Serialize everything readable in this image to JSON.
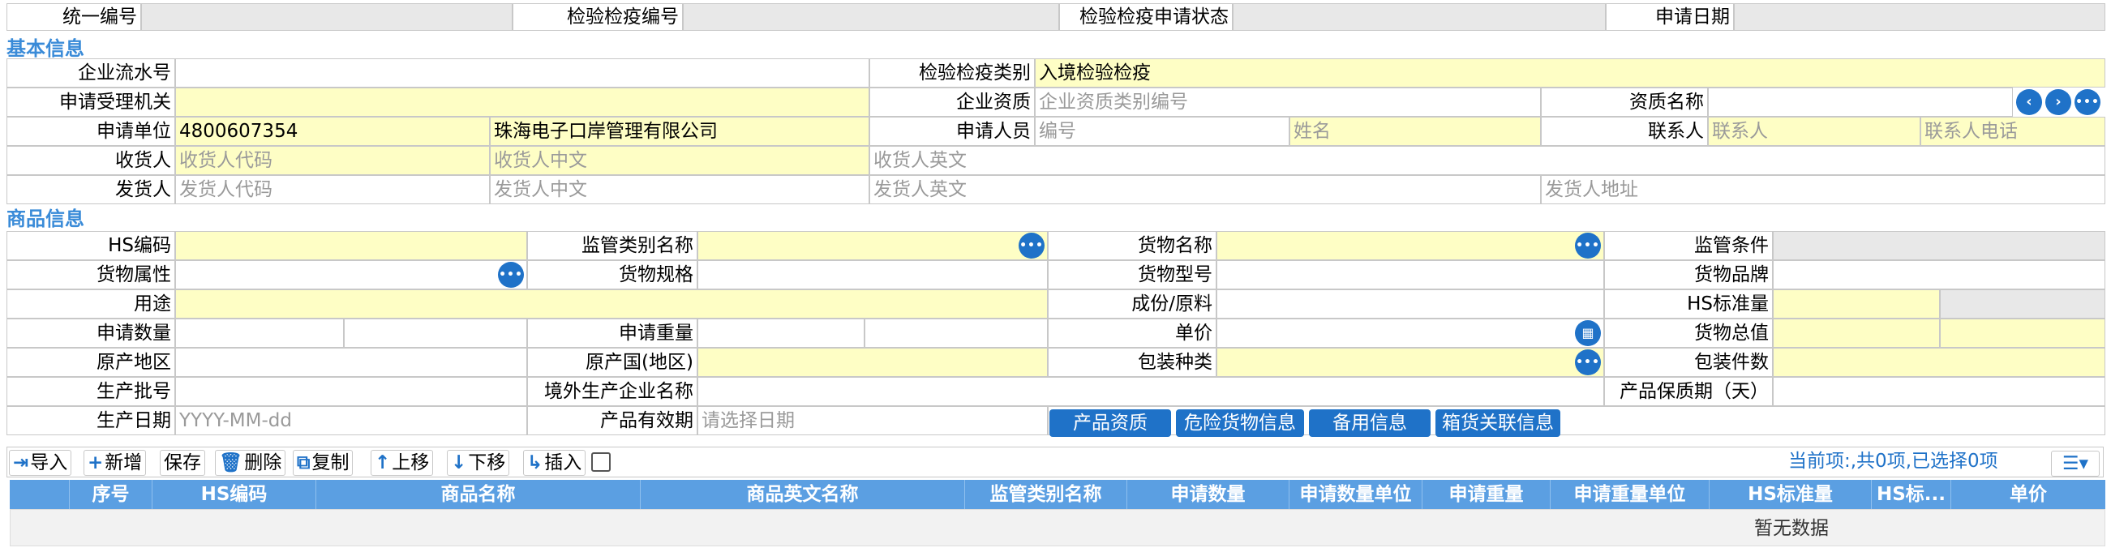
{
  "top": {
    "unified_no_label": "统一编号",
    "inspection_no_label": "检验检疫编号",
    "apply_status_label": "检验检疫申请状态",
    "apply_date_label": "申请日期"
  },
  "basic": {
    "section_title": "基本信息",
    "ent_serial_label": "企业流水号",
    "insp_category_label": "检验检疫类别",
    "insp_category_value": "入境检验检疫",
    "accept_org_label": "申请受理机关",
    "ent_qual_label": "企业资质",
    "ent_qual_placeholder": "企业资质类别编号",
    "qual_name_label": "资质名称",
    "applicant_label": "申请单位",
    "applicant_code": "4800607354",
    "applicant_name": "珠海电子口岸管理有限公司",
    "apply_person_label": "申请人员",
    "apply_person_no_ph": "编号",
    "apply_person_name_ph": "姓名",
    "contact_label": "联系人",
    "contact_ph": "联系人",
    "contact_phone_ph": "联系人电话",
    "consignee_label": "收货人",
    "consignee_code_ph": "收货人代码",
    "consignee_cn_ph": "收货人中文",
    "consignee_en_ph": "收货人英文",
    "consignor_label": "发货人",
    "consignor_code_ph": "发货人代码",
    "consignor_cn_ph": "发货人中文",
    "consignor_en_ph": "发货人英文",
    "consignor_addr_ph": "发货人地址"
  },
  "goods": {
    "section_title": "商品信息",
    "hs_code_label": "HS编码",
    "supervise_cat_label": "监管类别名称",
    "goods_name_label": "货物名称",
    "supervise_cond_label": "监管条件",
    "goods_attr_label": "货物属性",
    "goods_spec_label": "货物规格",
    "goods_model_label": "货物型号",
    "goods_brand_label": "货物品牌",
    "usage_label": "用途",
    "ingredient_label": "成份/原料",
    "hs_std_qty_label": "HS标准量",
    "apply_qty_label": "申请数量",
    "apply_weight_label": "申请重量",
    "unit_price_label": "单价",
    "total_value_label": "货物总值",
    "origin_area_label": "原产地区",
    "origin_country_label": "原产国(地区)",
    "pack_type_label": "包装种类",
    "pack_count_label": "包装件数",
    "batch_no_label": "生产批号",
    "foreign_producer_label": "境外生产企业名称",
    "shelf_life_label": "产品保质期（天）",
    "prod_date_label": "生产日期",
    "prod_date_ph": "YYYY-MM-dd",
    "valid_period_label": "产品有效期",
    "valid_period_ph": "请选择日期",
    "btn_product_qual": "产品资质",
    "btn_dangerous": "危险货物信息",
    "btn_spare": "备用信息",
    "btn_container": "箱货关联信息"
  },
  "toolbar": {
    "import": "导入",
    "add": "新增",
    "save": "保存",
    "delete": "删除",
    "copy": "复制",
    "move_up": "上移",
    "move_down": "下移",
    "insert": "插入",
    "status": "当前项:,共0项,已选择0项"
  },
  "grid": {
    "columns": [
      "序号",
      "HS编码",
      "商品名称",
      "商品英文名称",
      "监管类别名称",
      "申请数量",
      "申请数量单位",
      "申请重量",
      "申请重量单位",
      "HS标准量",
      "HS标...",
      "单价"
    ],
    "empty_text": "暂无数据"
  },
  "colors": {
    "accent": "#1f72c8",
    "section_title": "#3a8bd8",
    "required_bg": "#fefec5",
    "readonly_bg": "#e8e8e8",
    "grid_header": "#5b9fe2"
  }
}
